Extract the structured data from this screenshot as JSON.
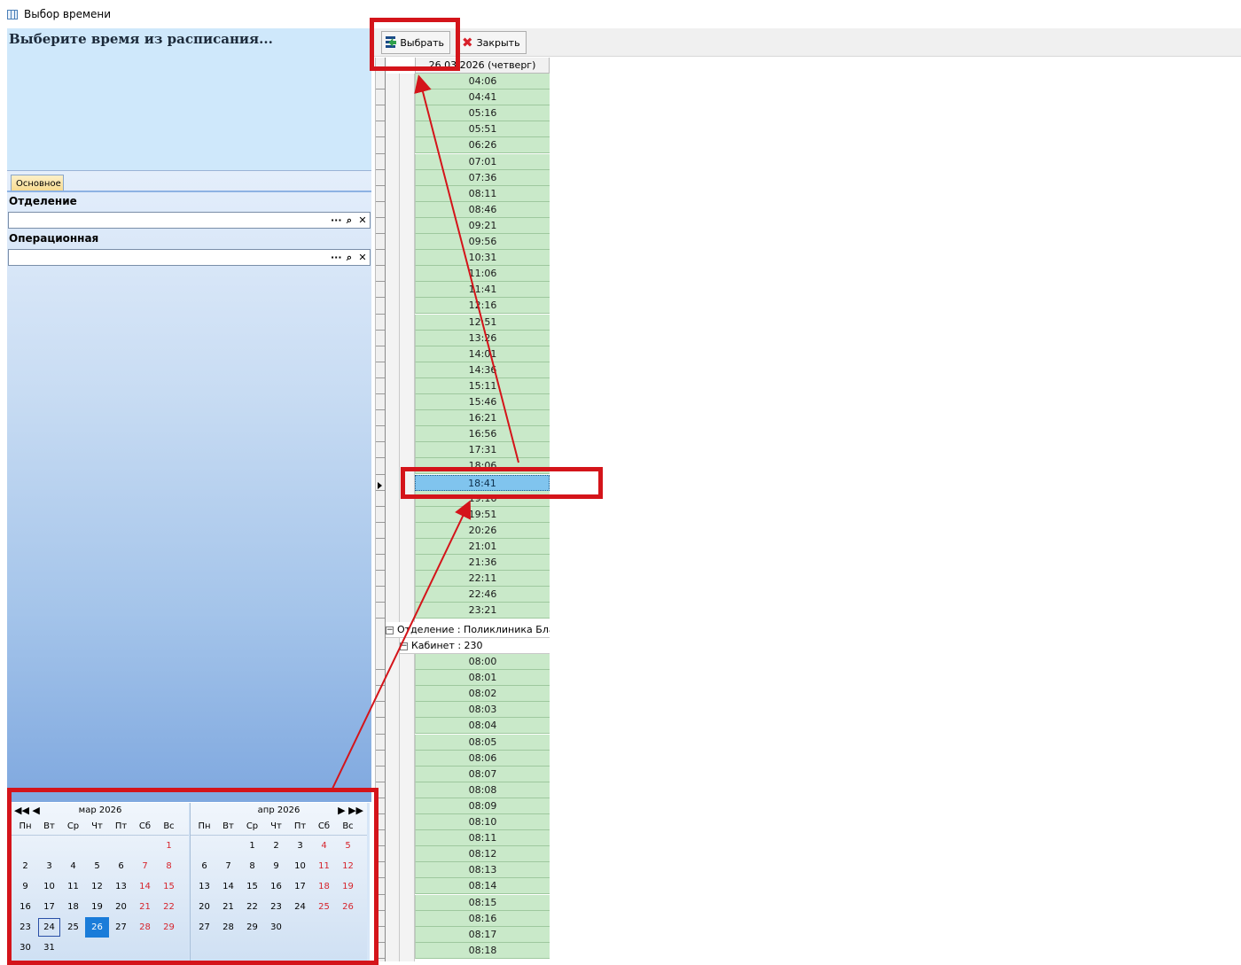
{
  "window": {
    "title": "Выбор времени",
    "icon": "table-icon"
  },
  "left": {
    "heading": "Выберите время из расписания...",
    "tab": "Основное",
    "fields": [
      {
        "label": "Отделение",
        "value": ""
      },
      {
        "label": "Операционная",
        "value": ""
      }
    ],
    "field_buttons": [
      "···",
      "🔍",
      "✕"
    ]
  },
  "toolbar": {
    "select_label": "Выбрать",
    "close_label": "Закрыть"
  },
  "grid": {
    "column_header": "26.03.2026 (четверг)",
    "times_group1": [
      "04:06",
      "04:41",
      "05:16",
      "05:51",
      "06:26",
      "07:01",
      "07:36",
      "08:11",
      "08:46",
      "09:21",
      "09:56",
      "10:31",
      "11:06",
      "11:41",
      "12:16",
      "12:51",
      "13:26",
      "14:01",
      "14:36",
      "15:11",
      "15:46",
      "16:21",
      "16:56",
      "17:31",
      "18:06",
      "18:41",
      "19:16",
      "19:51",
      "20:26",
      "21:01",
      "21:36",
      "22:11",
      "22:46",
      "23:21"
    ],
    "selected_time": "18:41",
    "group_department": "Отделение : Поликлиника Благо",
    "group_cabinet": "Кабинет : 230",
    "times_group2": [
      "08:00",
      "08:01",
      "08:02",
      "08:03",
      "08:04",
      "08:05",
      "08:06",
      "08:07",
      "08:08",
      "08:09",
      "08:10",
      "08:11",
      "08:12",
      "08:13",
      "08:14",
      "08:15",
      "08:16",
      "08:17",
      "08:18"
    ]
  },
  "calendar": {
    "weekdays": [
      "Пн",
      "Вт",
      "Ср",
      "Чт",
      "Пт",
      "Сб",
      "Вс"
    ],
    "months": [
      {
        "title": "мар 2026",
        "nav_left": "◀◀ ◀",
        "offset": 6,
        "days": [
          "1",
          "2",
          "3",
          "4",
          "5",
          "6",
          "7",
          "8",
          "9",
          "10",
          "11",
          "12",
          "13",
          "14",
          "15",
          "16",
          "17",
          "18",
          "19",
          "20",
          "21",
          "22",
          "23",
          "24",
          "25",
          "26",
          "27",
          "28",
          "29",
          "30",
          "31"
        ],
        "today": "24",
        "selected": "26"
      },
      {
        "title": "апр 2026",
        "nav_right": "▶ ▶▶",
        "offset": 2,
        "days": [
          "1",
          "2",
          "3",
          "4",
          "5",
          "6",
          "7",
          "8",
          "9",
          "10",
          "11",
          "12",
          "13",
          "14",
          "15",
          "16",
          "17",
          "18",
          "19",
          "20",
          "21",
          "22",
          "23",
          "24",
          "25",
          "26",
          "27",
          "28",
          "29",
          "30"
        ]
      }
    ]
  },
  "colors": {
    "free_slot": "#c9e9c9",
    "selected_slot": "#80c4ee",
    "annotation": "#d4141a",
    "weekend": "#d6242c",
    "calendar_selected": "#1a7cd9"
  }
}
